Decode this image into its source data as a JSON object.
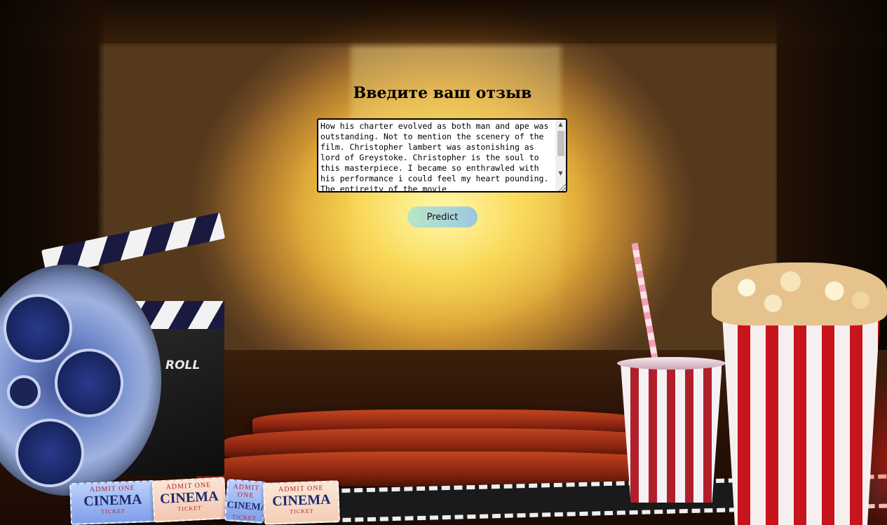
{
  "page": {
    "heading": "Введите ваш отзыв"
  },
  "review": {
    "value": "How his charter evolved as both man and ape was outstanding. Not to mention the scenery of the film. Christopher lambert was astonishing as lord of Greystoke. Christopher is the soul to this masterpiece. I became so enthrawled with his performance i could feel my heart pounding. The entireity of the movie"
  },
  "actions": {
    "predict_label": "Predict"
  },
  "scrollbar": {
    "up_glyph": "▲",
    "down_glyph": "▼"
  },
  "background": {
    "clapper_text": "ROLL",
    "tickets": [
      {
        "top": "ADMIT ONE",
        "main": "CINEMA",
        "bottom": "TICKET"
      },
      {
        "top": "ADMIT ONE",
        "main": "CINEMA",
        "bottom": "TICKET"
      },
      {
        "top": "ADMIT ONE",
        "main": "CINEMA",
        "bottom": "TICKET"
      },
      {
        "top": "ADMIT ONE",
        "main": "CINEMA",
        "bottom": "TICKET"
      }
    ]
  },
  "colors": {
    "button_gradient_start": "#b7e5c8",
    "button_gradient_end": "#9ec4e0",
    "screen_glow": "#fff4a0"
  }
}
